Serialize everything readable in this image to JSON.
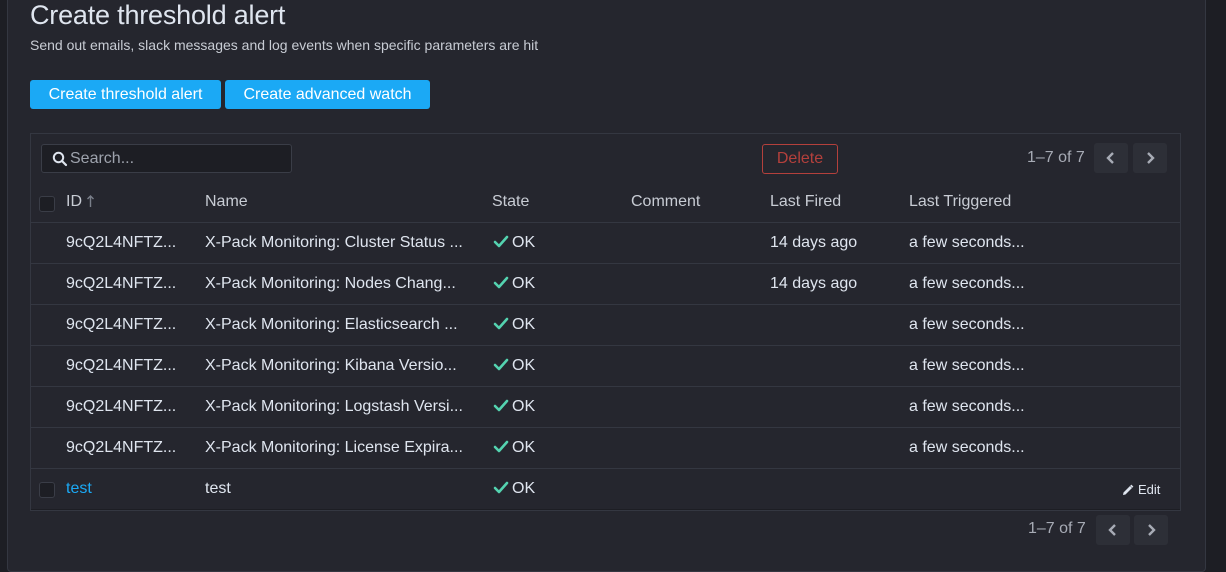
{
  "page": {
    "title": "Create threshold alert",
    "subtitle": "Send out emails, slack messages and log events when specific parameters are hit"
  },
  "actions": {
    "create_threshold": "Create threshold alert",
    "create_advanced": "Create advanced watch"
  },
  "toolbar": {
    "search_placeholder": "Search...",
    "delete_label": "Delete",
    "pager_text": "1–7 of 7"
  },
  "columns": {
    "id": "ID",
    "name": "Name",
    "state": "State",
    "comment": "Comment",
    "last_fired": "Last Fired",
    "last_triggered": "Last Triggered"
  },
  "rows": [
    {
      "id": "9cQ2L4NFTZ...",
      "name": "X-Pack Monitoring: Cluster Status ...",
      "state": "OK",
      "comment": "",
      "last_fired": "14 days ago",
      "last_triggered": "a few seconds..."
    },
    {
      "id": "9cQ2L4NFTZ...",
      "name": "X-Pack Monitoring: Nodes Chang...",
      "state": "OK",
      "comment": "",
      "last_fired": "14 days ago",
      "last_triggered": "a few seconds..."
    },
    {
      "id": "9cQ2L4NFTZ...",
      "name": "X-Pack Monitoring: Elasticsearch ...",
      "state": "OK",
      "comment": "",
      "last_fired": "",
      "last_triggered": "a few seconds..."
    },
    {
      "id": "9cQ2L4NFTZ...",
      "name": "X-Pack Monitoring: Kibana Versio...",
      "state": "OK",
      "comment": "",
      "last_fired": "",
      "last_triggered": "a few seconds..."
    },
    {
      "id": "9cQ2L4NFTZ...",
      "name": "X-Pack Monitoring: Logstash Versi...",
      "state": "OK",
      "comment": "",
      "last_fired": "",
      "last_triggered": "a few seconds..."
    },
    {
      "id": "9cQ2L4NFTZ...",
      "name": "X-Pack Monitoring: License Expira...",
      "state": "OK",
      "comment": "",
      "last_fired": "",
      "last_triggered": "a few seconds..."
    },
    {
      "id": "test",
      "name": "test",
      "state": "OK",
      "comment": "",
      "last_fired": "",
      "last_triggered": "",
      "edit": "Edit"
    }
  ],
  "footer": {
    "pager_text": "1–7 of 7"
  },
  "colors": {
    "accent": "#1ba9f5",
    "danger": "#b4403c",
    "ok": "#54d3b0"
  },
  "icons": {
    "search": "search-icon",
    "sort": "sort-arrow-up-icon",
    "ok": "check-icon",
    "edit": "pencil-icon",
    "prev": "chevron-left-icon",
    "next": "chevron-right-icon"
  }
}
